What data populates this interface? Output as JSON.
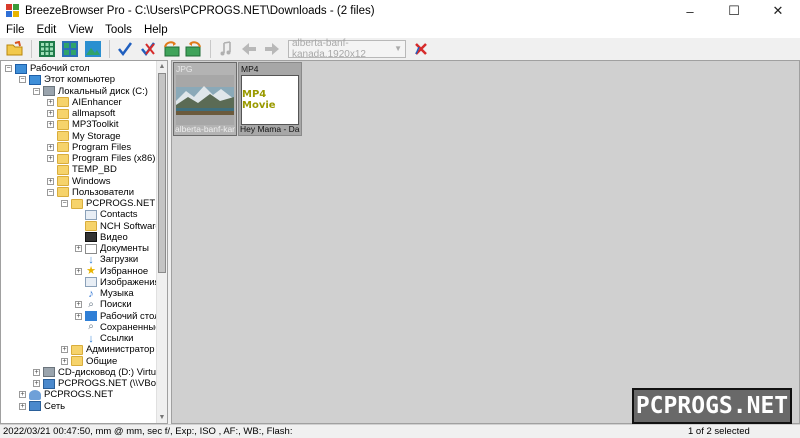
{
  "window": {
    "title": "BreezeBrowser Pro - C:\\Users\\PCPROGS.NET\\Downloads - (2 files)",
    "controls": [
      "–",
      "☐",
      "✕"
    ]
  },
  "menu": [
    "File",
    "Edit",
    "View",
    "Tools",
    "Help"
  ],
  "toolbar": {
    "buttons": [
      "open-folder-icon",
      "grid-small-icon",
      "grid-large-icon",
      "image-view-icon",
      "checkmark-icon",
      "clear-check-icon",
      "rotate-left-icon",
      "rotate-right-icon",
      "music-note-icon",
      "arrow-left-icon",
      "arrow-right-icon",
      "delete-icon"
    ],
    "combo_value": "alberta-banf-kanada.1920x12"
  },
  "tree": {
    "items": [
      {
        "label": "Рабочий стол",
        "level": 0,
        "exp": "-",
        "icon": "monitor"
      },
      {
        "label": "Этот компьютер",
        "level": 1,
        "exp": "-",
        "icon": "monitor"
      },
      {
        "label": "Локальный диск (C:)",
        "level": 2,
        "exp": "-",
        "icon": "drive"
      },
      {
        "label": "AIEnhancer",
        "level": 3,
        "exp": "+",
        "icon": "folder"
      },
      {
        "label": "allmapsoft",
        "level": 3,
        "exp": "+",
        "icon": "folder"
      },
      {
        "label": "MP3Toolkit",
        "level": 3,
        "exp": "+",
        "icon": "folder"
      },
      {
        "label": "My Storage",
        "level": 3,
        "exp": "",
        "icon": "folder"
      },
      {
        "label": "Program Files",
        "level": 3,
        "exp": "+",
        "icon": "folder"
      },
      {
        "label": "Program Files (x86)",
        "level": 3,
        "exp": "+",
        "icon": "folder"
      },
      {
        "label": "TEMP_BD",
        "level": 3,
        "exp": "",
        "icon": "folder"
      },
      {
        "label": "Windows",
        "level": 3,
        "exp": "+",
        "icon": "folder"
      },
      {
        "label": "Пользователи",
        "level": 3,
        "exp": "-",
        "icon": "folder"
      },
      {
        "label": "PCPROGS.NET",
        "level": 4,
        "exp": "-",
        "icon": "folder"
      },
      {
        "label": "Contacts",
        "level": 5,
        "exp": "",
        "icon": "card"
      },
      {
        "label": "NCH Software S",
        "level": 5,
        "exp": "",
        "icon": "folder"
      },
      {
        "label": "Видео",
        "level": 5,
        "exp": "",
        "icon": "film"
      },
      {
        "label": "Документы",
        "level": 5,
        "exp": "+",
        "icon": "doc"
      },
      {
        "label": "Загрузки",
        "level": 5,
        "exp": "",
        "icon": "down"
      },
      {
        "label": "Избранное",
        "level": 5,
        "exp": "+",
        "icon": "star"
      },
      {
        "label": "Изображения",
        "level": 5,
        "exp": "",
        "icon": "card"
      },
      {
        "label": "Музыка",
        "level": 5,
        "exp": "",
        "icon": "note"
      },
      {
        "label": "Поиски",
        "level": 5,
        "exp": "+",
        "icon": "search"
      },
      {
        "label": "Рабочий стол",
        "level": 5,
        "exp": "+",
        "icon": "blue"
      },
      {
        "label": "Сохраненные и",
        "level": 5,
        "exp": "",
        "icon": "search"
      },
      {
        "label": "Ссылки",
        "level": 5,
        "exp": "",
        "icon": "down"
      },
      {
        "label": "Администратор",
        "level": 4,
        "exp": "+",
        "icon": "folder"
      },
      {
        "label": "Общие",
        "level": 4,
        "exp": "+",
        "icon": "folder"
      },
      {
        "label": "CD-дисковод (D:) VirtualBox",
        "level": 2,
        "exp": "+",
        "icon": "drive"
      },
      {
        "label": "PCPROGS.NET (\\\\VBoxSvr",
        "level": 2,
        "exp": "+",
        "icon": "net"
      },
      {
        "label": "PCPROGS.NET",
        "level": 1,
        "exp": "+",
        "icon": "user"
      },
      {
        "label": "Сеть",
        "level": 1,
        "exp": "+",
        "icon": "net"
      }
    ]
  },
  "thumbnails": [
    {
      "type": "JPG",
      "name": "alberta-banf-kan",
      "kind": "photo"
    },
    {
      "type": "MP4",
      "name": "Hey Mama - Da",
      "kind": "movie",
      "preview_text": "MP4 Movie"
    }
  ],
  "status": {
    "exif": "2022/03/21 00:47:50, mm @ mm, sec f/, Exp:, ISO , AF:, WB:, Flash:",
    "selection": "1 of 2 selected"
  },
  "watermark": "PCPROGS.NET"
}
